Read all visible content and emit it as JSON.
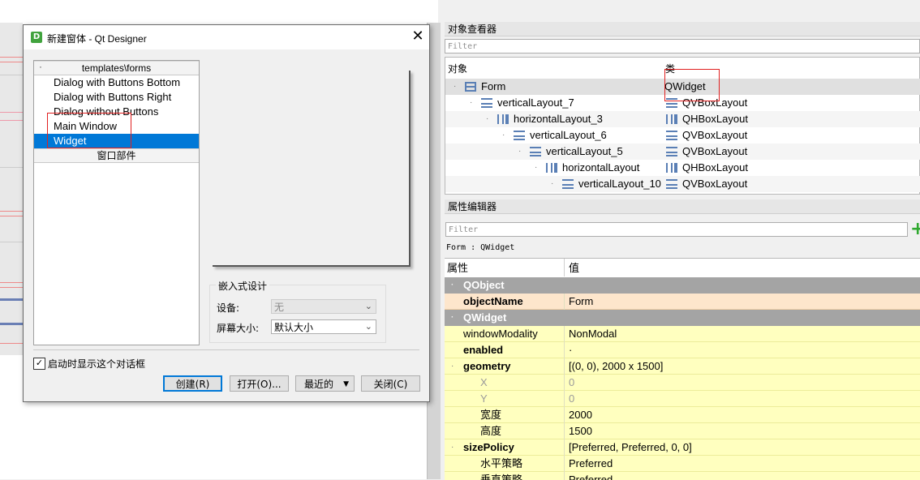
{
  "dialog": {
    "title": "新建窗体 - Qt Designer",
    "app_icon_letter": "D",
    "close_glyph": "✕",
    "templates_header": "templates\\forms",
    "templates": [
      {
        "label": "Dialog with Buttons Bottom"
      },
      {
        "label": "Dialog with Buttons Right"
      },
      {
        "label": "Dialog without Buttons"
      },
      {
        "label": "Main Window"
      },
      {
        "label": "Widget",
        "selected": true
      }
    ],
    "widgets_header": "窗口部件",
    "embedded_group_title": "嵌入式设计",
    "device_label": "设备:",
    "device_value": "无",
    "screen_size_label": "屏幕大小:",
    "screen_size_value": "默认大小",
    "startup_checkbox_label": "启动时显示这个对话框",
    "startup_checked": true,
    "buttons": {
      "create": "创建(R)",
      "open": "打开(O)...",
      "recent": "最近的",
      "close": "关闭(C)"
    }
  },
  "object_inspector": {
    "title": "对象查看器",
    "filter_placeholder": "Filter",
    "col_object": "对象",
    "col_class": "类",
    "rows": [
      {
        "name": "Form",
        "class": "QWidget",
        "icon": "form-icon",
        "class_icon": "none"
      },
      {
        "name": "verticalLayout_7",
        "class": "QVBoxLayout",
        "icon": "vbox-icon"
      },
      {
        "name": "horizontalLayout_3",
        "class": "QHBoxLayout",
        "icon": "hbox-icon"
      },
      {
        "name": "verticalLayout_6",
        "class": "QVBoxLayout",
        "icon": "vbox-icon"
      },
      {
        "name": "verticalLayout_5",
        "class": "QVBoxLayout",
        "icon": "vbox-icon"
      },
      {
        "name": "horizontalLayout",
        "class": "QHBoxLayout",
        "icon": "hbox-icon"
      },
      {
        "name": "verticalLayout_10",
        "class": "QVBoxLayout",
        "icon": "vbox-icon"
      }
    ]
  },
  "property_editor": {
    "title": "属性编辑器",
    "filter_placeholder": "Filter",
    "class_line": "Form : QWidget",
    "col_property": "属性",
    "col_value": "值",
    "rows": [
      {
        "type": "group",
        "key": "QObject",
        "value": ""
      },
      {
        "type": "orange",
        "key": "objectName",
        "value": "Form",
        "bold": true
      },
      {
        "type": "group",
        "key": "QWidget",
        "value": ""
      },
      {
        "type": "yellow",
        "key": "windowModality",
        "value": "NonModal"
      },
      {
        "type": "yellow",
        "key": "enabled",
        "value": "·",
        "bold": true
      },
      {
        "type": "yellow",
        "key": "geometry",
        "value": "[(0, 0), 2000 x 1500]",
        "bold": true,
        "expand": true
      },
      {
        "type": "sub-dim",
        "key": "X",
        "value": "0"
      },
      {
        "type": "sub-dim",
        "key": "Y",
        "value": "0"
      },
      {
        "type": "sub",
        "key": "宽度",
        "value": "2000"
      },
      {
        "type": "sub",
        "key": "高度",
        "value": "1500"
      },
      {
        "type": "yellow",
        "key": "sizePolicy",
        "value": "[Preferred, Preferred, 0, 0]",
        "bold": true,
        "expand": true
      },
      {
        "type": "sub",
        "key": "水平策略",
        "value": "Preferred"
      },
      {
        "type": "sub",
        "key": "垂直策略",
        "value": "Preferred"
      }
    ]
  },
  "colors": {
    "selection": "#0078d7",
    "highlight_box": "#e02020",
    "group_row": "#a4a4a4",
    "property_row": "#ffffbf",
    "changed_property_row": "#fde6cc"
  }
}
